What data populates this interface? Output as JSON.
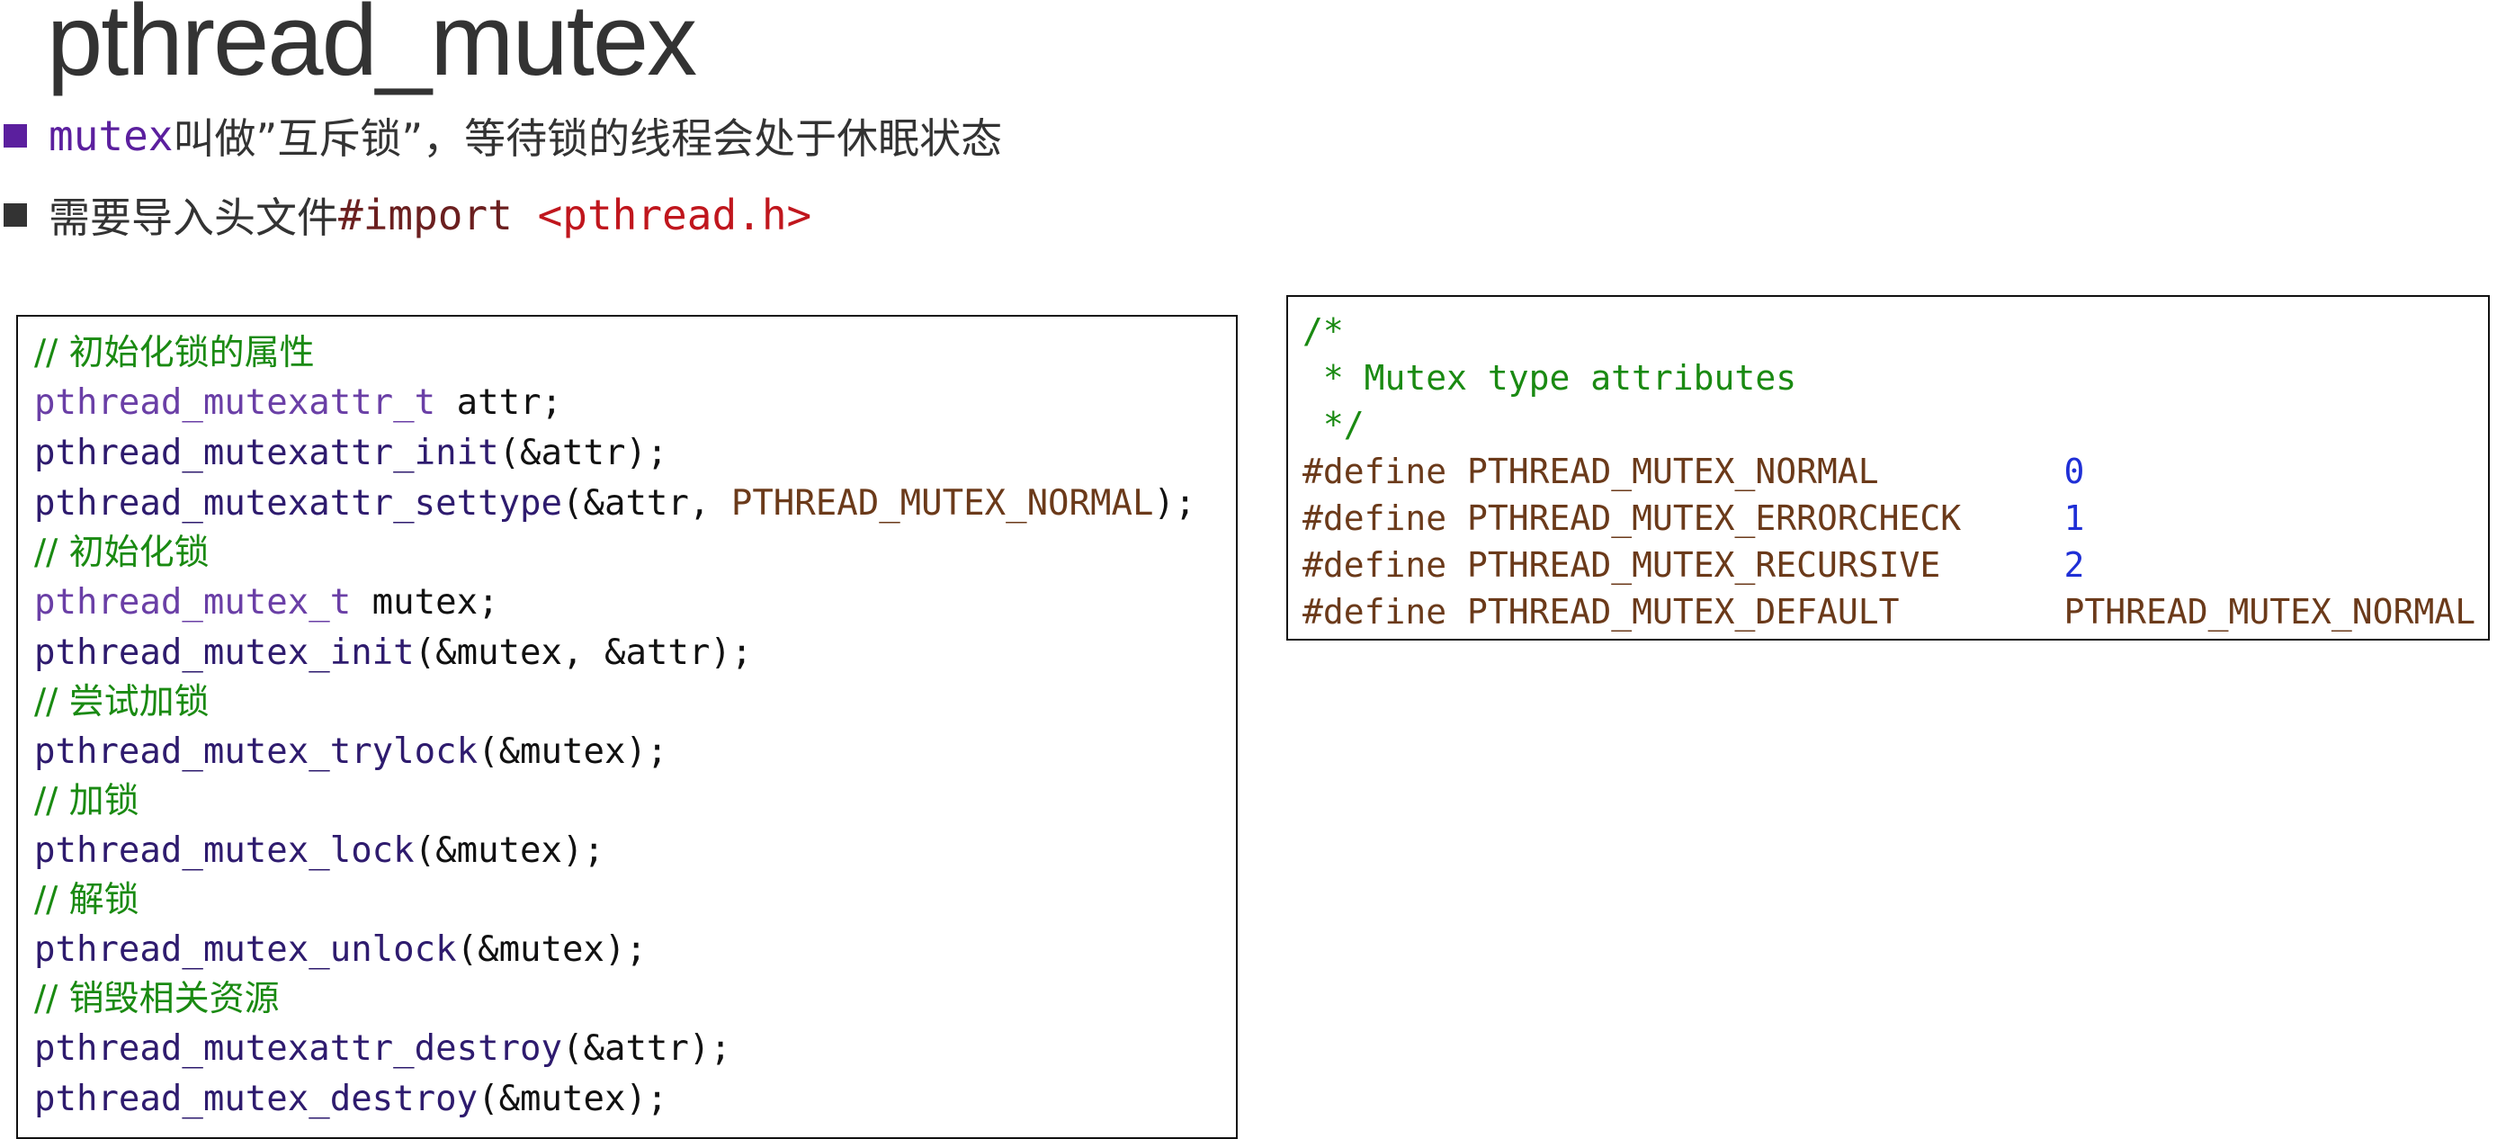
{
  "title": "pthread_mutex",
  "bullets": [
    {
      "code": "mutex",
      "text": "叫做”互斥锁”，等待锁的线程会处于休眠状态"
    },
    {
      "text": "需要导入头文件",
      "directive": "#import",
      "header": "<pthread.h>"
    }
  ],
  "left_code": {
    "c1": "// 初始化锁的属性",
    "l1_type": "pthread_mutexattr_t",
    "l1_rest": " attr;",
    "l2_func": "pthread_mutexattr_init",
    "l2_rest": "(&attr);",
    "l3_func": "pthread_mutexattr_settype",
    "l3_mid": "(&attr, ",
    "l3_const": "PTHREAD_MUTEX_NORMAL",
    "l3_end": ");",
    "c2": "// 初始化锁",
    "l4_type": "pthread_mutex_t",
    "l4_rest": " mutex;",
    "l5_func": "pthread_mutex_init",
    "l5_rest": "(&mutex, &attr);",
    "c3": "// 尝试加锁",
    "l6_func": "pthread_mutex_trylock",
    "l6_rest": "(&mutex);",
    "c4": "// 加锁",
    "l7_func": "pthread_mutex_lock",
    "l7_rest": "(&mutex);",
    "c5": "// 解锁",
    "l8_func": "pthread_mutex_unlock",
    "l8_rest": "(&mutex);",
    "c6": "// 销毁相关资源",
    "l9_func": "pthread_mutexattr_destroy",
    "l9_rest": "(&attr);",
    "l10_func": "pthread_mutex_destroy",
    "l10_rest": "(&mutex);"
  },
  "right_code": {
    "c1": "/*",
    "c2": " * Mutex type attributes",
    "c3": " */",
    "defines": [
      {
        "kw": "#define",
        "name": "PTHREAD_MUTEX_NORMAL",
        "value": "0"
      },
      {
        "kw": "#define",
        "name": "PTHREAD_MUTEX_ERRORCHECK",
        "value": "1"
      },
      {
        "kw": "#define",
        "name": "PTHREAD_MUTEX_RECURSIVE",
        "value": "2"
      },
      {
        "kw": "#define",
        "name": "PTHREAD_MUTEX_DEFAULT",
        "value": "PTHREAD_MUTEX_NORMAL"
      }
    ]
  },
  "colors": {
    "comment": "#1a8a12",
    "type": "#6a3fa6",
    "function": "#2e1b6e",
    "constant": "#6b3a1a",
    "number": "#1f2fd6",
    "bullet_accent": "#5b1f9e",
    "header_red": "#c0161d"
  }
}
